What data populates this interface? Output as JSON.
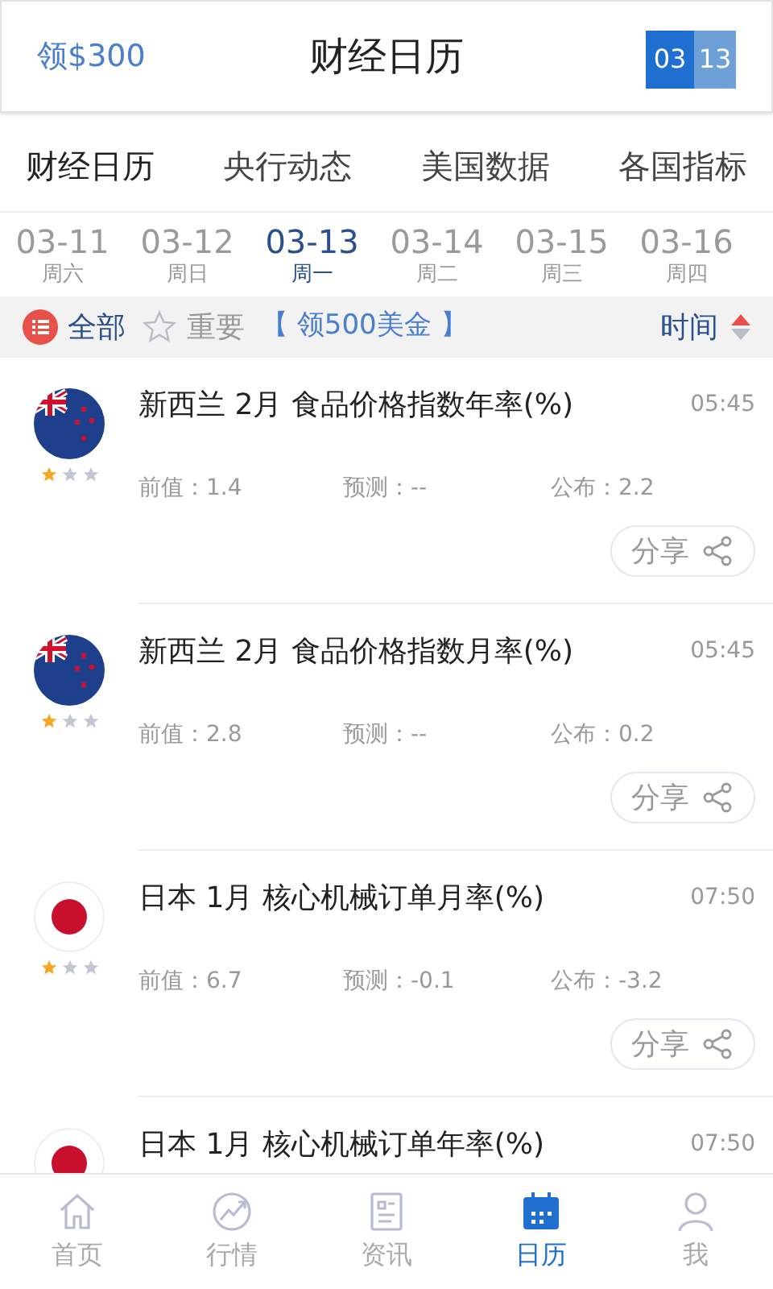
{
  "header": {
    "promo": "领$300",
    "title": "财经日历",
    "date_badge": [
      "03",
      "13"
    ]
  },
  "tabs": [
    {
      "label": "财经日历",
      "selected": true
    },
    {
      "label": "央行动态",
      "selected": false
    },
    {
      "label": "美国数据",
      "selected": false
    },
    {
      "label": "各国指标",
      "selected": false
    }
  ],
  "dates": [
    {
      "date": "03-11",
      "weekday": "周六",
      "selected": false
    },
    {
      "date": "03-12",
      "weekday": "周日",
      "selected": false
    },
    {
      "date": "03-13",
      "weekday": "周一",
      "selected": true
    },
    {
      "date": "03-14",
      "weekday": "周二",
      "selected": false
    },
    {
      "date": "03-15",
      "weekday": "周三",
      "selected": false
    },
    {
      "date": "03-16",
      "weekday": "周四",
      "selected": false
    }
  ],
  "filters": [
    {
      "label": "全部",
      "kind": "all",
      "selected": true
    },
    {
      "label": "重要",
      "kind": "important",
      "selected": false
    }
  ],
  "promo_link": "【 领500美金 】",
  "sort": {
    "label": "时间"
  },
  "events": [
    {
      "kind": "nz",
      "title": "新西兰 2月 食品价格指数年率(%)",
      "time": "05:45",
      "stars": 1,
      "previous": "前值：1.4",
      "forecast": "预测：--",
      "actual": "公布：2.2",
      "share": "分享"
    },
    {
      "kind": "nz",
      "title": "新西兰 2月 食品价格指数月率(%)",
      "time": "05:45",
      "stars": 1,
      "previous": "前值：2.8",
      "forecast": "预测：--",
      "actual": "公布：0.2",
      "share": "分享"
    },
    {
      "kind": "jp",
      "title": "日本 1月 核心机械订单月率(%)",
      "time": "07:50",
      "stars": 1,
      "previous": "前值：6.7",
      "forecast": "预测：-0.1",
      "actual": "公布：-3.2",
      "share": "分享"
    },
    {
      "kind": "jp",
      "title": "日本 1月 核心机械订单年率(%)",
      "time": "07:50"
    }
  ],
  "nav": [
    {
      "label": "首页",
      "kind": "home",
      "selected": false
    },
    {
      "label": "行情",
      "kind": "market",
      "selected": false
    },
    {
      "label": "资讯",
      "kind": "news",
      "selected": false
    },
    {
      "label": "日历",
      "kind": "calendar",
      "selected": true
    },
    {
      "label": "我",
      "kind": "me",
      "selected": false
    }
  ]
}
